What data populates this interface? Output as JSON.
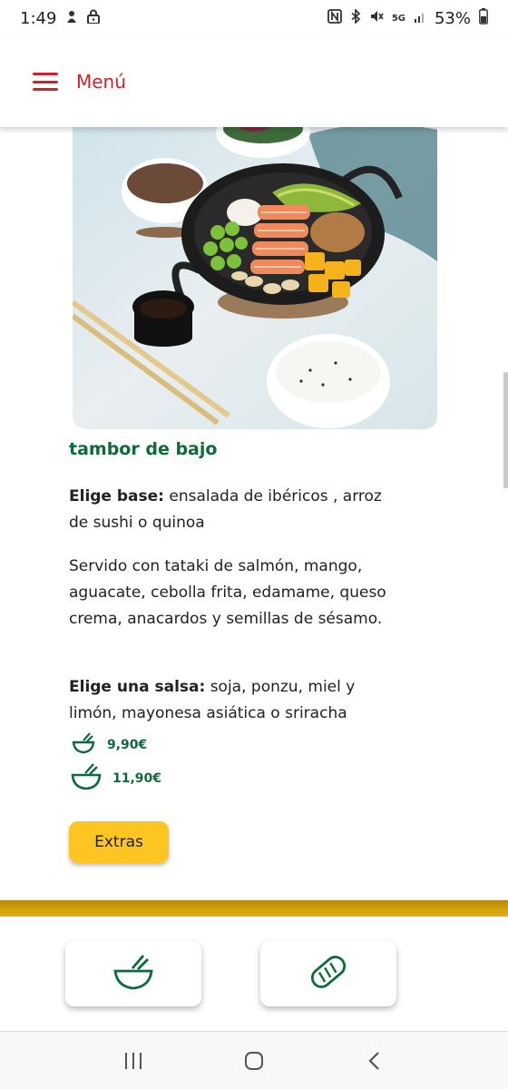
{
  "status_bar": {
    "time": "1:49",
    "battery": "53%",
    "icons": [
      "usb-debug-icon",
      "lock-icon",
      "nfc-icon",
      "bluetooth-icon",
      "mute-icon",
      "5g-icon",
      "signal-icon",
      "battery-icon"
    ]
  },
  "header": {
    "menu_label": "Menú",
    "accent_color": "#d1222b"
  },
  "dish": {
    "image": "poke-bowl-photo",
    "title": "tambor de bajo",
    "base_label": "Elige base:",
    "base_text": " ensalada de ibéricos , arroz de sushi o quinoa",
    "description": "Servido con tataki de salmón, mango, aguacate, cebolla frita, edamame, queso crema, anacardos y semillas de sésamo.",
    "sauce_label": "Elige una salsa:",
    "sauce_text": " soja, ponzu, miel y limón, mayonesa asiática o sriracha",
    "prices": [
      {
        "size_icon": "small-bowl-icon",
        "price": "9,90€"
      },
      {
        "size_icon": "large-bowl-icon",
        "price": "11,90€"
      }
    ],
    "extras_label": "Extras",
    "title_color": "#0d6b3a",
    "button_color": "#fcc521"
  },
  "bottom_nav": {
    "items": [
      {
        "icon": "bowl-icon"
      },
      {
        "icon": "bread-icon"
      }
    ]
  },
  "android_nav": {
    "items": [
      "recent-apps-icon",
      "home-icon",
      "back-icon"
    ]
  }
}
